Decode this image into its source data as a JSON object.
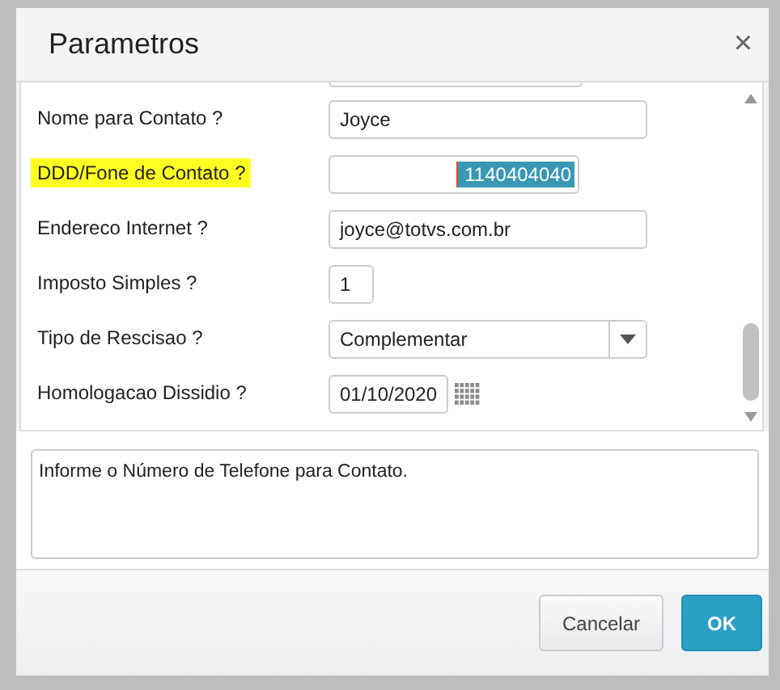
{
  "dialog": {
    "title": "Parametros",
    "close": "×"
  },
  "fields": [
    {
      "kind": "text",
      "label": "Nome para Contato ?",
      "value": "Joyce",
      "highlighted": false,
      "value_selected": false
    },
    {
      "kind": "numeric",
      "label": "DDD/Fone de Contato ?",
      "value": "1140404040",
      "highlighted": true,
      "value_selected": true
    },
    {
      "kind": "text",
      "label": "Endereco Internet ?",
      "value": "joyce@totvs.com.br",
      "highlighted": false,
      "value_selected": false
    },
    {
      "kind": "short",
      "label": "Imposto Simples ?",
      "value": "1",
      "highlighted": false,
      "value_selected": false
    },
    {
      "kind": "select",
      "label": "Tipo de Rescisao ?",
      "value": "Complementar",
      "highlighted": false,
      "value_selected": false
    },
    {
      "kind": "date",
      "label": "Homologacao Dissidio ?",
      "value": "01/10/2020",
      "highlighted": false,
      "value_selected": false
    }
  ],
  "help_text": "Informe o Número de Telefone para Contato.",
  "buttons": [
    {
      "label": "Cancelar",
      "primary": false
    },
    {
      "label": "OK",
      "primary": true
    }
  ]
}
